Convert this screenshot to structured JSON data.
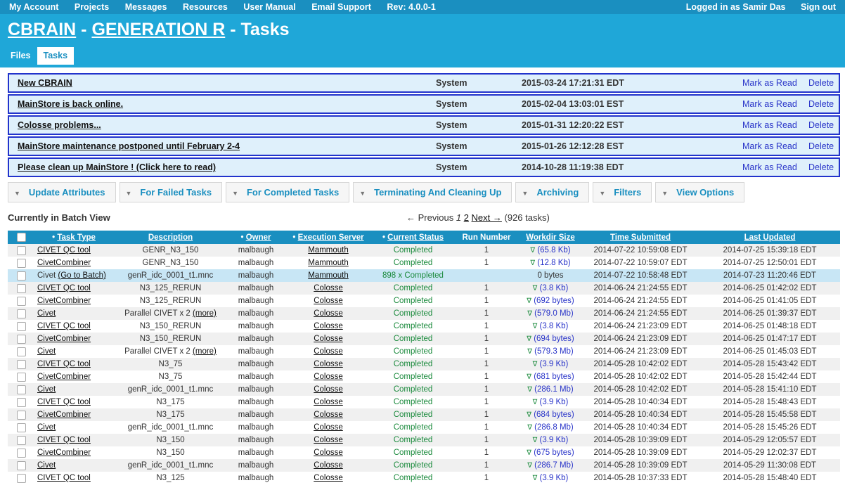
{
  "topnav": {
    "items": [
      "My Account",
      "Projects",
      "Messages",
      "Resources",
      "User Manual",
      "Email Support"
    ],
    "rev": "Rev: 4.0.0-1",
    "logged_in": "Logged in as Samir Das",
    "sign_out": "Sign out"
  },
  "header": {
    "app": "CBRAIN",
    "sep1": " - ",
    "project": "GENERATION R",
    "sep2": " - Tasks",
    "tabs": [
      "Files",
      "Tasks"
    ]
  },
  "messages": [
    {
      "title": "New CBRAIN",
      "source": "System",
      "date": "2015-03-24 17:21:31 EDT",
      "mark": "Mark as Read",
      "delete": "Delete"
    },
    {
      "title": "MainStore is back online.",
      "source": "System",
      "date": "2015-02-04 13:03:01 EST",
      "mark": "Mark as Read",
      "delete": "Delete"
    },
    {
      "title": "Colosse problems...",
      "source": "System",
      "date": "2015-01-31 12:20:22 EST",
      "mark": "Mark as Read",
      "delete": "Delete"
    },
    {
      "title": "MainStore maintenance postponed until February 2-4",
      "source": "System",
      "date": "2015-01-26 12:12:28 EST",
      "mark": "Mark as Read",
      "delete": "Delete"
    },
    {
      "title": "Please clean up MainStore ! (Click here to read)",
      "source": "System",
      "date": "2014-10-28 11:19:38 EDT",
      "mark": "Mark as Read",
      "delete": "Delete"
    }
  ],
  "toolbar": [
    "Update Attributes",
    "For Failed Tasks",
    "For Completed Tasks",
    "Terminating And Cleaning Up",
    "Archiving",
    "Filters",
    "View Options"
  ],
  "batch_label": "Currently in Batch View",
  "pager": {
    "prev": "← Previous",
    "page1": "1",
    "page2": "2",
    "next": "Next →",
    "count": "(926 tasks)"
  },
  "columns": {
    "task_type": "Task Type",
    "description": "Description",
    "owner": "Owner",
    "server": "Execution Server",
    "status": "Current Status",
    "run": "Run Number",
    "workdir": "Workdir Size",
    "submitted": "Time Submitted",
    "updated": "Last Updated"
  },
  "rows": [
    {
      "type": "CIVET QC tool",
      "desc": "GENR_N3_150",
      "owner": "malbaugh",
      "server": "Mammouth",
      "status": "Completed",
      "run": "1",
      "size": "(65.8 Kb)",
      "submitted": "2014-07-22 10:59:08 EDT",
      "updated": "2014-07-25 15:39:18 EDT"
    },
    {
      "type": "CivetCombiner",
      "desc": "GENR_N3_150",
      "owner": "malbaugh",
      "server": "Mammouth",
      "status": "Completed",
      "run": "1",
      "size": "(12.8 Kb)",
      "submitted": "2014-07-22 10:59:07 EDT",
      "updated": "2014-07-25 12:50:01 EDT"
    },
    {
      "type": "Civet",
      "batch_link": "(Go to Batch)",
      "desc": "genR_idc_0001_t1.mnc",
      "owner": "malbaugh",
      "server": "Mammouth",
      "status": "898 x Completed",
      "run": "",
      "size": "0 bytes",
      "submitted": "2014-07-22 10:58:48 EDT",
      "updated": "2014-07-23 11:20:46 EDT"
    },
    {
      "type": "CIVET QC tool",
      "desc": "N3_125_RERUN",
      "owner": "malbaugh",
      "server": "Colosse",
      "status": "Completed",
      "run": "1",
      "size": "(3.8 Kb)",
      "submitted": "2014-06-24 21:24:55 EDT",
      "updated": "2014-06-25 01:42:02 EDT"
    },
    {
      "type": "CivetCombiner",
      "desc": "N3_125_RERUN",
      "owner": "malbaugh",
      "server": "Colosse",
      "status": "Completed",
      "run": "1",
      "size": "(692 bytes)",
      "submitted": "2014-06-24 21:24:55 EDT",
      "updated": "2014-06-25 01:41:05 EDT"
    },
    {
      "type": "Civet",
      "desc": "Parallel CIVET x 2",
      "more": "(more)",
      "owner": "malbaugh",
      "server": "Colosse",
      "status": "Completed",
      "run": "1",
      "size": "(579.0 Mb)",
      "submitted": "2014-06-24 21:24:55 EDT",
      "updated": "2014-06-25 01:39:37 EDT"
    },
    {
      "type": "CIVET QC tool",
      "desc": "N3_150_RERUN",
      "owner": "malbaugh",
      "server": "Colosse",
      "status": "Completed",
      "run": "1",
      "size": "(3.8 Kb)",
      "submitted": "2014-06-24 21:23:09 EDT",
      "updated": "2014-06-25 01:48:18 EDT"
    },
    {
      "type": "CivetCombiner",
      "desc": "N3_150_RERUN",
      "owner": "malbaugh",
      "server": "Colosse",
      "status": "Completed",
      "run": "1",
      "size": "(694 bytes)",
      "submitted": "2014-06-24 21:23:09 EDT",
      "updated": "2014-06-25 01:47:17 EDT"
    },
    {
      "type": "Civet",
      "desc": "Parallel CIVET x 2",
      "more": "(more)",
      "owner": "malbaugh",
      "server": "Colosse",
      "status": "Completed",
      "run": "1",
      "size": "(579.3 Mb)",
      "submitted": "2014-06-24 21:23:09 EDT",
      "updated": "2014-06-25 01:45:03 EDT"
    },
    {
      "type": "CIVET QC tool",
      "desc": "N3_75",
      "owner": "malbaugh",
      "server": "Colosse",
      "status": "Completed",
      "run": "1",
      "size": "(3.9 Kb)",
      "submitted": "2014-05-28 10:42:02 EDT",
      "updated": "2014-05-28 15:43:42 EDT"
    },
    {
      "type": "CivetCombiner",
      "desc": "N3_75",
      "owner": "malbaugh",
      "server": "Colosse",
      "status": "Completed",
      "run": "1",
      "size": "(681 bytes)",
      "submitted": "2014-05-28 10:42:02 EDT",
      "updated": "2014-05-28 15:42:44 EDT"
    },
    {
      "type": "Civet",
      "desc": "genR_idc_0001_t1.mnc",
      "owner": "malbaugh",
      "server": "Colosse",
      "status": "Completed",
      "run": "1",
      "size": "(286.1 Mb)",
      "submitted": "2014-05-28 10:42:02 EDT",
      "updated": "2014-05-28 15:41:10 EDT"
    },
    {
      "type": "CIVET QC tool",
      "desc": "N3_175",
      "owner": "malbaugh",
      "server": "Colosse",
      "status": "Completed",
      "run": "1",
      "size": "(3.9 Kb)",
      "submitted": "2014-05-28 10:40:34 EDT",
      "updated": "2014-05-28 15:48:43 EDT"
    },
    {
      "type": "CivetCombiner",
      "desc": "N3_175",
      "owner": "malbaugh",
      "server": "Colosse",
      "status": "Completed",
      "run": "1",
      "size": "(684 bytes)",
      "submitted": "2014-05-28 10:40:34 EDT",
      "updated": "2014-05-28 15:45:58 EDT"
    },
    {
      "type": "Civet",
      "desc": "genR_idc_0001_t1.mnc",
      "owner": "malbaugh",
      "server": "Colosse",
      "status": "Completed",
      "run": "1",
      "size": "(286.8 Mb)",
      "submitted": "2014-05-28 10:40:34 EDT",
      "updated": "2014-05-28 15:45:26 EDT"
    },
    {
      "type": "CIVET QC tool",
      "desc": "N3_150",
      "owner": "malbaugh",
      "server": "Colosse",
      "status": "Completed",
      "run": "1",
      "size": "(3.9 Kb)",
      "submitted": "2014-05-28 10:39:09 EDT",
      "updated": "2014-05-29 12:05:57 EDT"
    },
    {
      "type": "CivetCombiner",
      "desc": "N3_150",
      "owner": "malbaugh",
      "server": "Colosse",
      "status": "Completed",
      "run": "1",
      "size": "(675 bytes)",
      "submitted": "2014-05-28 10:39:09 EDT",
      "updated": "2014-05-29 12:02:37 EDT"
    },
    {
      "type": "Civet",
      "desc": "genR_idc_0001_t1.mnc",
      "owner": "malbaugh",
      "server": "Colosse",
      "status": "Completed",
      "run": "1",
      "size": "(286.7 Mb)",
      "submitted": "2014-05-28 10:39:09 EDT",
      "updated": "2014-05-29 11:30:08 EDT"
    },
    {
      "type": "CIVET QC tool",
      "desc": "N3_125",
      "owner": "malbaugh",
      "server": "Colosse",
      "status": "Completed",
      "run": "1",
      "size": "(3.9 Kb)",
      "submitted": "2014-05-28 10:37:33 EDT",
      "updated": "2014-05-28 15:48:40 EDT"
    }
  ]
}
